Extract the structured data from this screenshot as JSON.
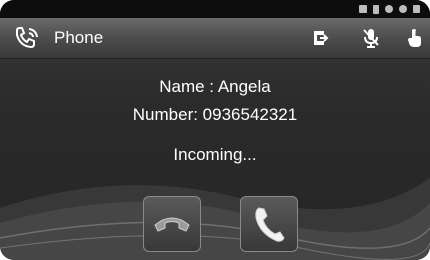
{
  "app": {
    "title": "Phone"
  },
  "caller": {
    "name_line": "Name : Angela",
    "number_line": "Number: 0936542321",
    "status": "Incoming..."
  },
  "icons": {
    "app": "phone-app-icon",
    "toolbar": [
      "hold-icon",
      "mute-icon",
      "hand-icon"
    ],
    "status_bar": [
      "notification-icon",
      "battery-icon",
      "usb-icon",
      "bluetooth-icon",
      "signal-icon"
    ]
  },
  "actions": {
    "decline": "decline-call",
    "answer": "answer-call"
  }
}
